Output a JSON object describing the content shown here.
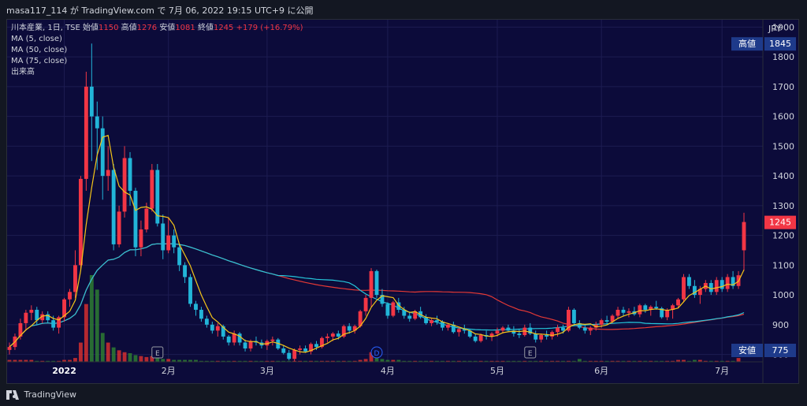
{
  "header": {
    "text": "masa117_114 が TradingView.com で 7月 06, 2022 19:15 UTC+9 に公開"
  },
  "footer": {
    "logo_text": "TradingView"
  },
  "legend": {
    "symbol": "川本産業, 1日, TSE",
    "open_label": "始値",
    "open": "1150",
    "high_label": "高値",
    "high": "1276",
    "low_label": "安値",
    "low": "1081",
    "close_label": "終値",
    "close": "1245",
    "change": "+179 (+16.79%)",
    "indicators": [
      "MA (5, close)",
      "MA (50, close)",
      "MA (75, close)",
      "出来高"
    ]
  },
  "price_scale": {
    "currency": "JPY",
    "ticks": [
      "1900",
      "1800",
      "1700",
      "1600",
      "1500",
      "1400",
      "1300",
      "1200",
      "1100",
      "1000",
      "900",
      "800"
    ],
    "high_badge": {
      "label": "高値",
      "value": "1845"
    },
    "last_badge": {
      "value": "1245"
    },
    "low_badge": {
      "label": "安値",
      "value": "775"
    }
  },
  "time_axis": {
    "labels": [
      "2022",
      "2月",
      "3月",
      "4月",
      "5月",
      "6月",
      "7月"
    ]
  },
  "events": [
    {
      "marker": "E",
      "x": "2022-01-28"
    },
    {
      "marker": "D",
      "x": "2022-03-30"
    },
    {
      "marker": "E",
      "x": "2022-05-13"
    }
  ],
  "colors": {
    "up": "#f23645",
    "down": "#22b5d8",
    "ma5": "#f5c518",
    "ma50": "#26c6da",
    "ma75": "#e53935",
    "vol_up": "#d32f2f",
    "vol_down": "#2e7d32",
    "background": "#0c0b3a"
  },
  "chart_data": {
    "type": "candlestick",
    "ylim": [
      775,
      1925
    ],
    "x": [
      "12-17",
      "12-20",
      "12-21",
      "12-22",
      "12-23",
      "12-24",
      "12-27",
      "12-28",
      "12-29",
      "12-30",
      "01-04",
      "01-05",
      "01-06",
      "01-07",
      "01-11",
      "01-12",
      "01-13",
      "01-14",
      "01-17",
      "01-18",
      "01-19",
      "01-20",
      "01-21",
      "01-24",
      "01-25",
      "01-26",
      "01-27",
      "01-28",
      "01-31",
      "02-01",
      "02-02",
      "02-03",
      "02-04",
      "02-07",
      "02-08",
      "02-09",
      "02-10",
      "02-14",
      "02-15",
      "02-16",
      "02-17",
      "02-18",
      "02-21",
      "02-22",
      "02-24",
      "02-25",
      "02-28",
      "03-01",
      "03-02",
      "03-03",
      "03-04",
      "03-07",
      "03-08",
      "03-09",
      "03-10",
      "03-11",
      "03-14",
      "03-15",
      "03-16",
      "03-17",
      "03-18",
      "03-22",
      "03-23",
      "03-24",
      "03-25",
      "03-28",
      "03-29",
      "03-30",
      "03-31",
      "04-01",
      "04-04",
      "04-05",
      "04-06",
      "04-07",
      "04-08",
      "04-11",
      "04-12",
      "04-13",
      "04-14",
      "04-15",
      "04-18",
      "04-19",
      "04-20",
      "04-21",
      "04-22",
      "04-25",
      "04-26",
      "04-27",
      "04-28",
      "05-02",
      "05-06",
      "05-09",
      "05-10",
      "05-11",
      "05-12",
      "05-13",
      "05-16",
      "05-17",
      "05-18",
      "05-19",
      "05-20",
      "05-23",
      "05-24",
      "05-25",
      "05-26",
      "05-27",
      "05-30",
      "05-31",
      "06-01",
      "06-02",
      "06-03",
      "06-06",
      "06-07",
      "06-08",
      "06-09",
      "06-10",
      "06-13",
      "06-14",
      "06-15",
      "06-16",
      "06-17",
      "06-20",
      "06-21",
      "06-22",
      "06-23",
      "06-24",
      "06-27",
      "06-28",
      "06-29",
      "06-30",
      "07-01",
      "07-04",
      "07-05",
      "07-06"
    ],
    "ohlc": [
      [
        815,
        840,
        800,
        825
      ],
      [
        825,
        870,
        815,
        860
      ],
      [
        860,
        920,
        850,
        905
      ],
      [
        905,
        950,
        880,
        940
      ],
      [
        940,
        965,
        915,
        950
      ],
      [
        950,
        960,
        900,
        915
      ],
      [
        915,
        945,
        905,
        935
      ],
      [
        935,
        945,
        905,
        915
      ],
      [
        915,
        930,
        880,
        890
      ],
      [
        890,
        930,
        870,
        925
      ],
      [
        925,
        990,
        910,
        985
      ],
      [
        985,
        1020,
        960,
        1010
      ],
      [
        1010,
        1150,
        990,
        1100
      ],
      [
        1100,
        1400,
        1080,
        1390
      ],
      [
        1390,
        1750,
        1350,
        1700
      ],
      [
        1700,
        1845,
        1450,
        1600
      ],
      [
        1600,
        1650,
        1420,
        1560
      ],
      [
        1560,
        1600,
        1320,
        1400
      ],
      [
        1400,
        1500,
        1350,
        1420
      ],
      [
        1420,
        1440,
        1150,
        1170
      ],
      [
        1170,
        1300,
        1160,
        1280
      ],
      [
        1280,
        1500,
        1260,
        1460
      ],
      [
        1460,
        1480,
        1300,
        1350
      ],
      [
        1350,
        1360,
        1130,
        1160
      ],
      [
        1160,
        1250,
        1130,
        1220
      ],
      [
        1220,
        1310,
        1210,
        1290
      ],
      [
        1290,
        1440,
        1280,
        1420
      ],
      [
        1420,
        1440,
        1230,
        1240
      ],
      [
        1240,
        1270,
        1120,
        1150
      ],
      [
        1150,
        1260,
        1140,
        1200
      ],
      [
        1200,
        1220,
        1140,
        1160
      ],
      [
        1160,
        1170,
        1080,
        1100
      ],
      [
        1100,
        1110,
        1040,
        1060
      ],
      [
        1060,
        1070,
        960,
        970
      ],
      [
        970,
        980,
        930,
        950
      ],
      [
        950,
        960,
        910,
        920
      ],
      [
        920,
        930,
        890,
        900
      ],
      [
        900,
        910,
        870,
        880
      ],
      [
        880,
        905,
        860,
        895
      ],
      [
        895,
        900,
        850,
        860
      ],
      [
        860,
        865,
        830,
        840
      ],
      [
        840,
        880,
        830,
        870
      ],
      [
        870,
        875,
        830,
        840
      ],
      [
        840,
        850,
        810,
        820
      ],
      [
        820,
        850,
        810,
        845
      ],
      [
        845,
        860,
        830,
        840
      ],
      [
        840,
        850,
        820,
        830
      ],
      [
        830,
        850,
        815,
        845
      ],
      [
        845,
        860,
        830,
        850
      ],
      [
        850,
        855,
        815,
        820
      ],
      [
        820,
        830,
        800,
        805
      ],
      [
        805,
        815,
        780,
        785
      ],
      [
        785,
        820,
        775,
        815
      ],
      [
        815,
        830,
        800,
        820
      ],
      [
        820,
        830,
        805,
        810
      ],
      [
        810,
        840,
        800,
        835
      ],
      [
        835,
        845,
        815,
        825
      ],
      [
        825,
        860,
        820,
        855
      ],
      [
        855,
        870,
        840,
        860
      ],
      [
        860,
        875,
        845,
        870
      ],
      [
        870,
        880,
        850,
        860
      ],
      [
        860,
        900,
        855,
        895
      ],
      [
        895,
        905,
        870,
        880
      ],
      [
        880,
        900,
        870,
        895
      ],
      [
        895,
        950,
        890,
        945
      ],
      [
        945,
        1000,
        930,
        990
      ],
      [
        990,
        1090,
        960,
        1080
      ],
      [
        1080,
        1085,
        990,
        1000
      ],
      [
        1000,
        1020,
        960,
        970
      ],
      [
        970,
        975,
        920,
        930
      ],
      [
        930,
        980,
        925,
        975
      ],
      [
        975,
        990,
        940,
        950
      ],
      [
        950,
        960,
        920,
        930
      ],
      [
        930,
        940,
        910,
        920
      ],
      [
        920,
        950,
        915,
        945
      ],
      [
        945,
        960,
        920,
        925
      ],
      [
        925,
        935,
        900,
        905
      ],
      [
        905,
        920,
        895,
        915
      ],
      [
        915,
        930,
        900,
        910
      ],
      [
        910,
        915,
        880,
        890
      ],
      [
        890,
        905,
        880,
        900
      ],
      [
        900,
        910,
        870,
        875
      ],
      [
        875,
        890,
        860,
        885
      ],
      [
        885,
        900,
        870,
        880
      ],
      [
        880,
        885,
        855,
        860
      ],
      [
        860,
        870,
        840,
        845
      ],
      [
        845,
        870,
        840,
        865
      ],
      [
        865,
        880,
        850,
        860
      ],
      [
        860,
        875,
        845,
        870
      ],
      [
        870,
        890,
        860,
        880
      ],
      [
        880,
        895,
        870,
        890
      ],
      [
        890,
        900,
        875,
        880
      ],
      [
        880,
        895,
        860,
        870
      ],
      [
        870,
        885,
        855,
        865
      ],
      [
        865,
        900,
        860,
        890
      ],
      [
        890,
        905,
        865,
        870
      ],
      [
        870,
        880,
        840,
        850
      ],
      [
        850,
        870,
        840,
        865
      ],
      [
        865,
        880,
        850,
        860
      ],
      [
        860,
        880,
        850,
        875
      ],
      [
        875,
        900,
        860,
        890
      ],
      [
        890,
        900,
        870,
        880
      ],
      [
        880,
        960,
        875,
        950
      ],
      [
        950,
        955,
        900,
        905
      ],
      [
        905,
        915,
        885,
        890
      ],
      [
        890,
        900,
        870,
        880
      ],
      [
        880,
        895,
        865,
        890
      ],
      [
        890,
        910,
        880,
        900
      ],
      [
        900,
        920,
        890,
        915
      ],
      [
        915,
        930,
        900,
        910
      ],
      [
        910,
        935,
        905,
        930
      ],
      [
        930,
        960,
        920,
        950
      ],
      [
        950,
        960,
        930,
        940
      ],
      [
        940,
        955,
        925,
        945
      ],
      [
        945,
        960,
        930,
        935
      ],
      [
        935,
        970,
        925,
        965
      ],
      [
        965,
        970,
        940,
        950
      ],
      [
        950,
        965,
        930,
        960
      ],
      [
        960,
        980,
        950,
        955
      ],
      [
        955,
        960,
        920,
        925
      ],
      [
        925,
        955,
        915,
        950
      ],
      [
        950,
        970,
        920,
        965
      ],
      [
        965,
        990,
        955,
        985
      ],
      [
        985,
        1070,
        975,
        1060
      ],
      [
        1060,
        1070,
        1020,
        1030
      ],
      [
        1030,
        1050,
        990,
        1000
      ],
      [
        1000,
        1030,
        970,
        1020
      ],
      [
        1020,
        1050,
        1010,
        1040
      ],
      [
        1040,
        1050,
        1000,
        1010
      ],
      [
        1010,
        1060,
        1000,
        1050
      ],
      [
        1050,
        1060,
        1010,
        1020
      ],
      [
        1020,
        1070,
        1010,
        1060
      ],
      [
        1060,
        1080,
        1020,
        1030
      ],
      [
        1030,
        1080,
        1020,
        1066
      ],
      [
        1150,
        1276,
        1081,
        1245
      ]
    ],
    "volume_scale": "relative",
    "volume": [
      2,
      2,
      2,
      2,
      2,
      1,
      1,
      1,
      1,
      1,
      2,
      2,
      4,
      20,
      60,
      90,
      75,
      30,
      20,
      15,
      12,
      10,
      9,
      7,
      6,
      5,
      6,
      5,
      3,
      3,
      2,
      2,
      2,
      2,
      2,
      1,
      1,
      1,
      1,
      1,
      1,
      1,
      1,
      1,
      1,
      1,
      1,
      1,
      1,
      1,
      1,
      1,
      1,
      1,
      1,
      1,
      1,
      1,
      1,
      1,
      1,
      1,
      1,
      1,
      2,
      3,
      10,
      5,
      3,
      2,
      2,
      2,
      1,
      1,
      1,
      1,
      1,
      1,
      1,
      1,
      1,
      1,
      1,
      1,
      1,
      1,
      1,
      1,
      1,
      1,
      1,
      1,
      1,
      1,
      1,
      1,
      1,
      1,
      1,
      1,
      1,
      1,
      1,
      1,
      3,
      1,
      1,
      1,
      1,
      1,
      1,
      1,
      1,
      1,
      1,
      1,
      1,
      1,
      1,
      1,
      1,
      1,
      2,
      2,
      1,
      2,
      2,
      1,
      1,
      1,
      1,
      1,
      1,
      4
    ],
    "series": [
      {
        "name": "MA (5, close)"
      },
      {
        "name": "MA (50, close)"
      },
      {
        "name": "MA (75, close)"
      }
    ]
  }
}
